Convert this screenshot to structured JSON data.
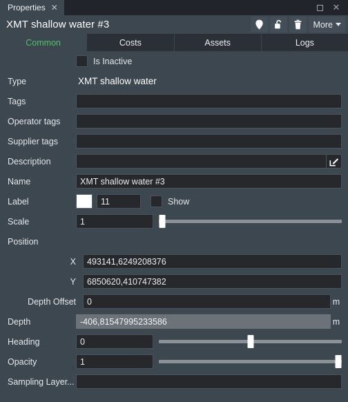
{
  "window": {
    "tab_title": "Properties",
    "close_tab_glyph": "✕",
    "restore_glyph": "restore",
    "close_glyph": "✕"
  },
  "header": {
    "title": "XMT shallow water #3",
    "actions": [
      {
        "name": "pin-icon",
        "label": "Pin"
      },
      {
        "name": "unlock-icon",
        "label": "Unlock"
      },
      {
        "name": "trash-icon",
        "label": "Delete"
      }
    ],
    "more_label": "More"
  },
  "tabs": [
    {
      "label": "Common",
      "active": true
    },
    {
      "label": "Costs",
      "active": false
    },
    {
      "label": "Assets",
      "active": false
    },
    {
      "label": "Logs",
      "active": false
    }
  ],
  "form": {
    "is_inactive": {
      "label": "Is Inactive",
      "checked": false
    },
    "type": {
      "label": "Type",
      "value": "XMT shallow water"
    },
    "tags": {
      "label": "Tags",
      "value": ""
    },
    "operator_tags": {
      "label": "Operator tags",
      "value": ""
    },
    "supplier_tags": {
      "label": "Supplier tags",
      "value": ""
    },
    "description": {
      "label": "Description",
      "value": "",
      "edit_icon": "edit-pencil-icon"
    },
    "name": {
      "label": "Name",
      "value": "XMT shallow water #3"
    },
    "label_row": {
      "label": "Label",
      "color": "#ffffff",
      "size_value": "11",
      "show_label": "Show",
      "show_checked": false
    },
    "scale": {
      "label": "Scale",
      "value": "1",
      "slider_percent": 2
    },
    "position": {
      "label": "Position",
      "x": {
        "label": "X",
        "value": "493141,6249208376"
      },
      "y": {
        "label": "Y",
        "value": "6850620,410747382"
      },
      "depth_offset": {
        "label": "Depth Offset",
        "value": "0",
        "unit": "m"
      }
    },
    "depth": {
      "label": "Depth",
      "value": "-406,81547995233586",
      "unit": "m",
      "readonly": true
    },
    "heading": {
      "label": "Heading",
      "value": "0",
      "slider_percent": 50
    },
    "opacity": {
      "label": "Opacity",
      "value": "1",
      "slider_percent": 98
    },
    "sampling_layer": {
      "label": "Sampling Layer...",
      "value": ""
    }
  },
  "colors": {
    "panel": "#3d4750",
    "titlebar": "#21252b",
    "tabbar": "#2b3037",
    "field": "#26282b",
    "accent_green": "#4dc06a",
    "readonly": "#6b7278"
  }
}
